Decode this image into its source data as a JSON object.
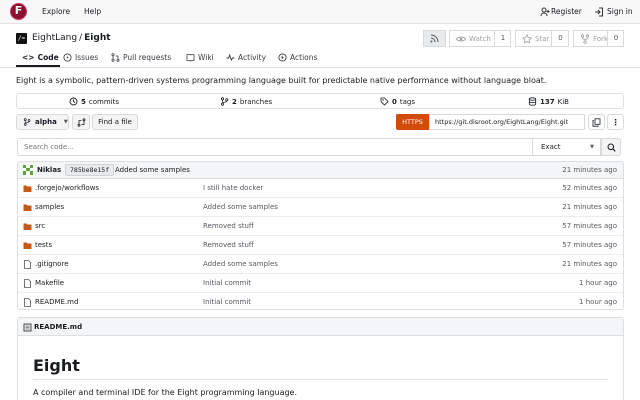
{
  "nav": {
    "explore": "Explore",
    "help": "Help",
    "register": "Register",
    "signin": "Sign in",
    "logo_letter": "F"
  },
  "repo": {
    "owner": "EightLang",
    "separator": "/",
    "name": "Eight",
    "avatar_text": "/="
  },
  "actions": {
    "watch": {
      "label": "Watch",
      "count": "1"
    },
    "star": {
      "label": "Star",
      "count": "0"
    },
    "fork": {
      "label": "Fork",
      "count": "0"
    }
  },
  "tabs": [
    "Code",
    "Issues",
    "Pull requests",
    "Wiki",
    "Activity",
    "Actions"
  ],
  "description": "Eight is a symbolic, pattern-driven systems programming language built for predictable native performance without language bloat.",
  "stats": {
    "commits": {
      "count": "5",
      "label": "commits"
    },
    "branches": {
      "count": "2",
      "label": "branches"
    },
    "tags": {
      "count": "0",
      "label": "tags"
    },
    "size": {
      "count": "137",
      "label": "KiB"
    }
  },
  "branch": {
    "name": "alpha",
    "find_file": "Find a file"
  },
  "clone": {
    "protocol": "HTTPS",
    "url": "https://git.disroot.org/EightLang/Eight.git"
  },
  "search": {
    "placeholder": "Search code...",
    "mode": "Exact"
  },
  "latest_commit": {
    "author": "Niklas",
    "sha": "785be8e15f",
    "message": "Added some samples",
    "time": "21 minutes ago"
  },
  "files": [
    {
      "name": ".forgejo/workflows",
      "type": "folder",
      "message": "I still hate docker",
      "time": "52 minutes ago"
    },
    {
      "name": "samples",
      "type": "folder",
      "message": "Added some samples",
      "time": "21 minutes ago"
    },
    {
      "name": "src",
      "type": "folder",
      "message": "Removed stuff",
      "time": "57 minutes ago"
    },
    {
      "name": "tests",
      "type": "folder",
      "message": "Removed stuff",
      "time": "57 minutes ago"
    },
    {
      "name": ".gitignore",
      "type": "file",
      "message": "Added some samples",
      "time": "21 minutes ago"
    },
    {
      "name": "Makefile",
      "type": "file",
      "message": "Initial commit",
      "time": "1 hour ago"
    },
    {
      "name": "README.md",
      "type": "file",
      "message": "Initial commit",
      "time": "1 hour ago"
    }
  ],
  "readme": {
    "filename": "README.md",
    "heading": "Eight",
    "text": "A compiler and terminal IDE for the Eight programming language."
  },
  "colors": {
    "accent": "#d24b0a",
    "logo": "#8b0f2e",
    "folder": "#c4591a"
  }
}
